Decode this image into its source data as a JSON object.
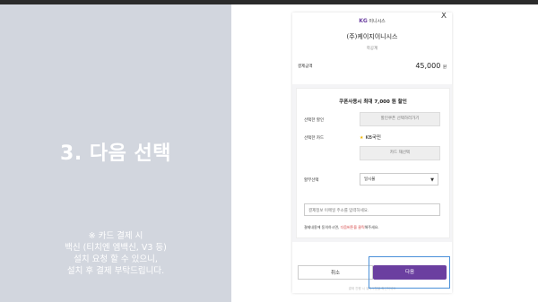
{
  "slide": {
    "title": "3. 다음 선택",
    "note": "※ 카드 결제 시\n백신 (티치엔 엠백신, V3 등)\n설치 요청 할 수 있으니,\n설치 후 결제 부탁드립니다."
  },
  "dialog": {
    "close": "X",
    "logo_brand": "KG",
    "logo_text": "이니시스",
    "merchant": "(주)케이지이니시스",
    "merchant_sub": "학공계",
    "amount_label": "결제금액",
    "amount_value": "45,000",
    "amount_unit": "원",
    "coupon_title": "쿠폰사용시 최대 7,000 원 할인",
    "discount_label": "선택한 할인",
    "discount_button": "할인쿠폰 선택하러가기",
    "card_label": "선택한 카드",
    "card_mark": "★",
    "card_name": "KB국민",
    "card_change_button": "카드 재선택",
    "installment_label": "할부선택",
    "installment_value": "일시불",
    "email_placeholder": "결제정보 이메일 주소를 입력하세요.",
    "notice_prefix": "결제내용에 동의하시면, ",
    "notice_highlight": "다음버튼을 클릭",
    "notice_suffix": "해주세요.",
    "cancel_button": "취소",
    "next_button": "다음",
    "footer_hint": "결제 진행 시 유의사항을 확인하세요"
  },
  "colors": {
    "accent": "#6b3fa0",
    "left_panel": "#d2d6de",
    "highlight_box": "#4a90d9",
    "notice_red": "#d23a3a"
  }
}
